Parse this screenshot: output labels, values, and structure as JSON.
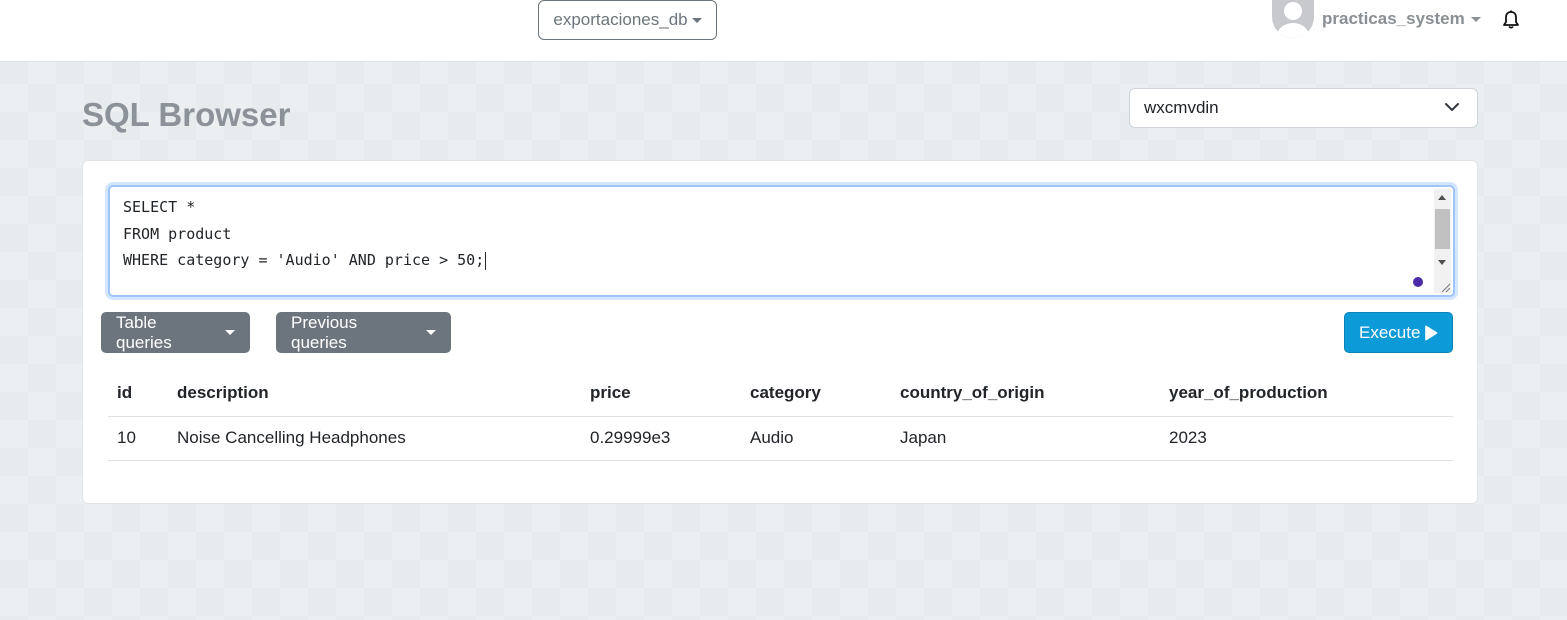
{
  "navbar": {
    "database_select": "exportaciones_db",
    "user_name": "practicas_system"
  },
  "page": {
    "title": "SQL Browser",
    "connection_select": "wxcmvdin"
  },
  "editor": {
    "lines": [
      "SELECT *",
      "FROM product",
      "WHERE category = 'Audio' AND price > 50;"
    ]
  },
  "buttons": {
    "table_queries": "Table queries",
    "previous_queries": "Previous queries",
    "execute": "Execute"
  },
  "results": {
    "columns": [
      "id",
      "description",
      "price",
      "category",
      "country_of_origin",
      "year_of_production"
    ],
    "rows": [
      [
        "10",
        "Noise Cancelling Headphones",
        "0.29999e3",
        "Audio",
        "Japan",
        "2023"
      ]
    ]
  },
  "colors": {
    "execute_button": "#0c9bd8",
    "secondary_button": "#6c757d",
    "title": "#8b929a"
  },
  "icons": {
    "notifications": "bell-icon",
    "execute": "play-icon",
    "select": "chevron-down-icon"
  }
}
